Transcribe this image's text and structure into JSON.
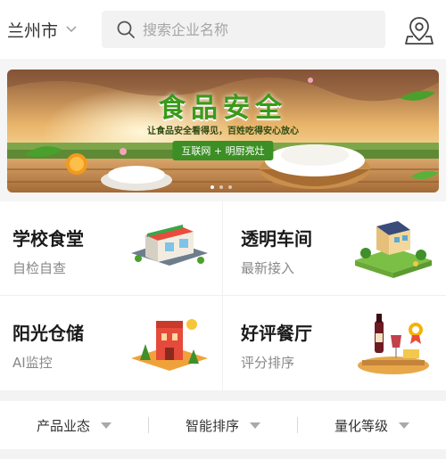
{
  "header": {
    "city": "兰州市",
    "search_placeholder": "搜索企业名称"
  },
  "banner": {
    "title": "食品安全",
    "subtitle": "让食品安全看得见，百姓吃得安心放心",
    "tag": "互联网 + 明厨亮灶"
  },
  "categories": [
    {
      "title": "学校食堂",
      "subtitle": "自检自查",
      "icon": "school-canteen-icon"
    },
    {
      "title": "透明车间",
      "subtitle": "最新接入",
      "icon": "transparent-workshop-icon"
    },
    {
      "title": "阳光仓储",
      "subtitle": "AI监控",
      "icon": "warehouse-icon"
    },
    {
      "title": "好评餐厅",
      "subtitle": "评分排序",
      "icon": "restaurant-icon"
    }
  ],
  "filters": [
    {
      "label": "产品业态"
    },
    {
      "label": "智能排序"
    },
    {
      "label": "量化等级"
    }
  ]
}
